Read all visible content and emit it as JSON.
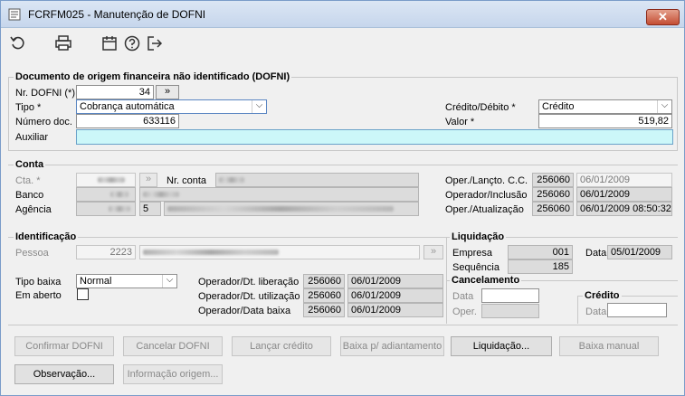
{
  "window": {
    "title": "FCRFM025 - Manutenção de DOFNI",
    "close_symbol": "✕"
  },
  "toolbar": {
    "icons": [
      "refresh-icon",
      "print-icon",
      "calendar-icon",
      "help-icon",
      "exit-icon"
    ]
  },
  "dofni": {
    "legend": "Documento de origem financeira não identificado (DOFNI)",
    "nr_label": "Nr. DOFNI (*)",
    "nr_value": "34",
    "nr_lookup": "»",
    "tipo_label": "Tipo *",
    "tipo_value": "Cobrança automática",
    "numero_label": "Número doc.",
    "numero_value": "633116",
    "auxiliar_label": "Auxiliar",
    "auxiliar_value": "",
    "cd_label": "Crédito/Débito *",
    "cd_value": "Crédito",
    "valor_label": "Valor *",
    "valor_value": "519,82"
  },
  "conta": {
    "legend": "Conta",
    "cta_label": "Cta. *",
    "nr_conta_label": "Nr. conta",
    "banco_label": "Banco",
    "agencia_label": "Agência",
    "agencia_digit": "5",
    "lookup": "»",
    "oper_lancto_label": "Oper./Lançto. C.C.",
    "oper_lancto_op": "256060",
    "oper_lancto_date": "06/01/2009",
    "oper_incl_label": "Operador/Inclusão",
    "oper_incl_op": "256060",
    "oper_incl_date": "06/01/2009",
    "oper_atual_label": "Oper./Atualização",
    "oper_atual_op": "256060",
    "oper_atual_date": "06/01/2009 08:50:32"
  },
  "identificacao": {
    "legend": "Identificação",
    "pessoa_label": "Pessoa",
    "pessoa_value": "2223",
    "lookup": "»",
    "tipo_baixa_label": "Tipo baixa",
    "tipo_baixa_value": "Normal",
    "em_aberto_label": "Em aberto",
    "em_aberto_checked": false,
    "liberacao_label": "Operador/Dt. liberação",
    "liberacao_op": "256060",
    "liberacao_date": "06/01/2009",
    "utilizacao_label": "Operador/Dt. utilização",
    "utilizacao_op": "256060",
    "utilizacao_date": "06/01/2009",
    "baixa_label": "Operador/Data baixa",
    "baixa_op": "256060",
    "baixa_date": "06/01/2009"
  },
  "liquidacao": {
    "legend": "Liquidação",
    "empresa_label": "Empresa",
    "empresa_value": "001",
    "sequencia_label": "Sequência",
    "sequencia_value": "185",
    "data_label": "Data",
    "data_value": "05/01/2009"
  },
  "cancelamento": {
    "legend": "Cancelamento",
    "data_label": "Data",
    "oper_label": "Oper."
  },
  "credito": {
    "legend": "Crédito",
    "data_label": "Data"
  },
  "buttons": {
    "confirmar": "Confirmar DOFNI",
    "cancelar": "Cancelar DOFNI",
    "lancar": "Lançar crédito",
    "baixa_adiant": "Baixa p/ adiantamento",
    "liquidacao": "Liquidação...",
    "baixa_manual": "Baixa manual",
    "observacao": "Observação...",
    "informacao": "Informação origem..."
  },
  "colors": {
    "aux_field": "#ccf7f9",
    "readonly": "#dcdcdc",
    "close": "#c44d33"
  }
}
